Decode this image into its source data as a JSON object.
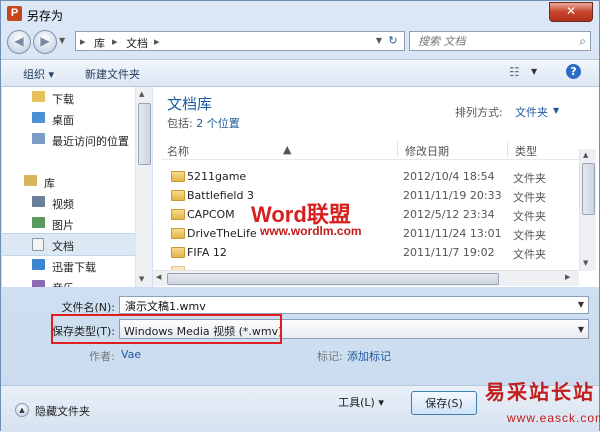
{
  "window": {
    "title": "另存为",
    "app_icon": "P",
    "close": "✕"
  },
  "address": {
    "segments": [
      "库",
      "文档"
    ],
    "search_placeholder": "搜索 文档"
  },
  "toolbar": {
    "organize": "组织 ▾",
    "new_folder": "新建文件夹"
  },
  "sidebar": {
    "items": [
      {
        "label": "下载",
        "icon": "download-folder-icon"
      },
      {
        "label": "桌面",
        "icon": "desktop-icon"
      },
      {
        "label": "最近访问的位置",
        "icon": "recent-places-icon"
      },
      {
        "label": "库",
        "icon": "library-icon"
      },
      {
        "label": "视频",
        "icon": "video-library-icon"
      },
      {
        "label": "图片",
        "icon": "pictures-library-icon"
      },
      {
        "label": "文档",
        "icon": "documents-library-icon",
        "selected": true
      },
      {
        "label": "迅雷下载",
        "icon": "xunlei-download-icon"
      },
      {
        "label": "音乐",
        "icon": "music-library-icon"
      }
    ]
  },
  "library": {
    "title": "文档库",
    "includes_label": "包括:",
    "includes_link": "2 个位置",
    "arrange_label": "排列方式:",
    "arrange_value": "文件夹"
  },
  "columns": {
    "name": "名称",
    "date": "修改日期",
    "type": "类型"
  },
  "files": [
    {
      "name": "5211game",
      "date": "2012/10/4 18:54",
      "type": "文件夹"
    },
    {
      "name": "Battlefield 3",
      "date": "2011/11/19 20:33",
      "type": "文件夹"
    },
    {
      "name": "CAPCOM",
      "date": "2012/5/12 23:34",
      "type": "文件夹"
    },
    {
      "name": "DriveTheLife",
      "date": "2011/11/24 13:01",
      "type": "文件夹"
    },
    {
      "name": "FIFA 12",
      "date": "2011/11/7 19:02",
      "type": "文件夹"
    }
  ],
  "watermark": {
    "word": "Word",
    "lianmeng": "联盟",
    "url": "www.wordlm.com"
  },
  "form": {
    "filename_label": "文件名(N):",
    "filename_value": "演示文稿1.wmv",
    "filetype_label": "保存类型(T):",
    "filetype_value": "Windows Media 视频 (*.wmv)",
    "author_label": "作者:",
    "author_value": "Vae",
    "tags_label": "标记:",
    "tags_value": "添加标记"
  },
  "bottom": {
    "hide_folders": "隐藏文件夹",
    "tools": "工具(L)  ▾",
    "save": "保存(S)"
  },
  "brand": {
    "name": "易采站长站",
    "url": "www.easck.com"
  },
  "colors": {
    "accent": "#1e5a9e",
    "highlight_box": "#e02020",
    "brand": "#c21d1d"
  }
}
